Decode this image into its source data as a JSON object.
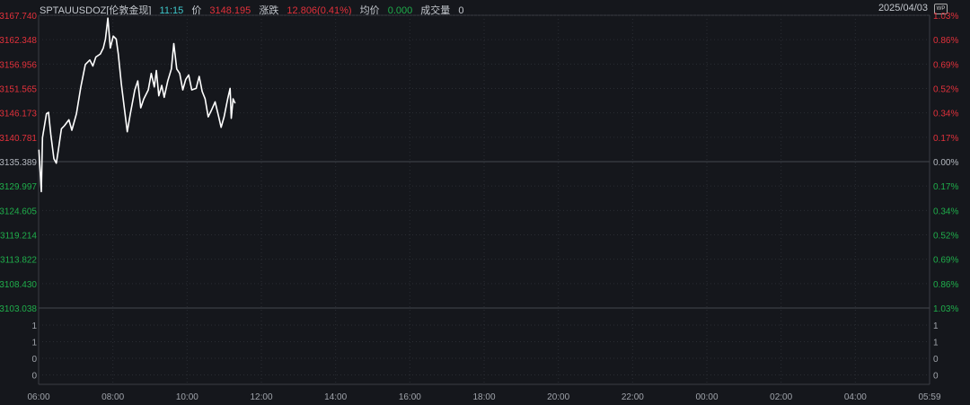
{
  "header": {
    "symbol": "SPTAUUSDOZ[伦敦金现]",
    "time": "11:15",
    "price_label": "价",
    "price_value": "3148.195",
    "change_label": "涨跌",
    "change_value": "12.806(0.41%)",
    "avg_label": "均价",
    "avg_value": "0.000",
    "volume_label": "成交量",
    "volume_value": "0",
    "date": "2025/04/03",
    "icon": "wp-icon"
  },
  "colors": {
    "up": "#e2313b",
    "down": "#1fae4b",
    "line": "#ffffff",
    "bg": "#15171c"
  },
  "chart_data": {
    "type": "line",
    "title": "SPTAUUSDOZ[伦敦金现]",
    "base_price": 3135.389,
    "ylim": [
      3103.038,
      3167.74
    ],
    "y_ticks": [
      "3167.740",
      "3162.348",
      "3156.956",
      "3151.565",
      "3146.173",
      "3140.781",
      "3135.389",
      "3129.997",
      "3124.605",
      "3119.214",
      "3113.822",
      "3108.430",
      "3103.038"
    ],
    "pct_ticks": [
      "1.03%",
      "0.86%",
      "0.69%",
      "0.52%",
      "0.34%",
      "0.17%",
      "0.00%",
      "0.17%",
      "0.34%",
      "0.52%",
      "0.69%",
      "0.86%",
      "1.03%"
    ],
    "volume_ticks": [
      "1",
      "1",
      "0",
      "0"
    ],
    "x_ticks": [
      "06:00",
      "08:00",
      "10:00",
      "12:00",
      "14:00",
      "16:00",
      "18:00",
      "20:00",
      "22:00",
      "00:00",
      "02:00",
      "04:00",
      "05:59"
    ],
    "x_unit": "minutes since 06:00",
    "xlim": [
      0,
      1439
    ],
    "grid": true,
    "series": [
      {
        "name": "price",
        "points": [
          [
            0.5,
            3138.03
          ],
          [
            4.4,
            3128.78
          ],
          [
            6.3,
            3140.68
          ],
          [
            12.6,
            3145.96
          ],
          [
            16,
            3146.29
          ],
          [
            19.8,
            3141.34
          ],
          [
            24.7,
            3136.05
          ],
          [
            28.6,
            3135.06
          ],
          [
            31.9,
            3138.03
          ],
          [
            36.8,
            3142.66
          ],
          [
            41.6,
            3143.32
          ],
          [
            48.9,
            3144.64
          ],
          [
            53.7,
            3142.33
          ],
          [
            61,
            3145.96
          ],
          [
            68.2,
            3151.91
          ],
          [
            75.5,
            3156.86
          ],
          [
            82.7,
            3157.85
          ],
          [
            87.6,
            3156.53
          ],
          [
            92.4,
            3158.52
          ],
          [
            99.7,
            3159.18
          ],
          [
            104.5,
            3160.5
          ],
          [
            107.9,
            3162.48
          ],
          [
            111.8,
            3167.1
          ],
          [
            115.7,
            3160.5
          ],
          [
            120.5,
            3163.14
          ],
          [
            125.3,
            3162.48
          ],
          [
            128.7,
            3159.18
          ],
          [
            133.6,
            3152.57
          ],
          [
            138.4,
            3147.28
          ],
          [
            143.2,
            3142.0
          ],
          [
            148.1,
            3145.96
          ],
          [
            155.3,
            3151.25
          ],
          [
            160.2,
            3153.23
          ],
          [
            165,
            3147.28
          ],
          [
            169.8,
            3149.27
          ],
          [
            177.1,
            3151.25
          ],
          [
            181.9,
            3154.88
          ],
          [
            186.8,
            3151.91
          ],
          [
            190.2,
            3155.54
          ],
          [
            194.1,
            3149.93
          ],
          [
            198.9,
            3152.24
          ],
          [
            202.8,
            3149.59
          ],
          [
            208.6,
            3153.23
          ],
          [
            214.4,
            3155.87
          ],
          [
            218.3,
            3161.49
          ],
          [
            223.1,
            3155.87
          ],
          [
            227.9,
            3154.88
          ],
          [
            232.8,
            3151.25
          ],
          [
            237.6,
            3153.56
          ],
          [
            242.4,
            3154.55
          ],
          [
            247.3,
            3151.25
          ],
          [
            254.5,
            3151.58
          ],
          [
            259.4,
            3154.22
          ],
          [
            264.2,
            3150.91
          ],
          [
            269,
            3149.27
          ],
          [
            273.9,
            3145.3
          ],
          [
            278.7,
            3146.63
          ],
          [
            285,
            3148.61
          ],
          [
            290.8,
            3145.3
          ],
          [
            294.7,
            3142.98
          ],
          [
            299.5,
            3145.3
          ],
          [
            305.3,
            3149.27
          ],
          [
            309.2,
            3151.58
          ],
          [
            311.1,
            3144.97
          ],
          [
            314,
            3149.27
          ],
          [
            317.4,
            3148.27
          ]
        ]
      }
    ]
  }
}
